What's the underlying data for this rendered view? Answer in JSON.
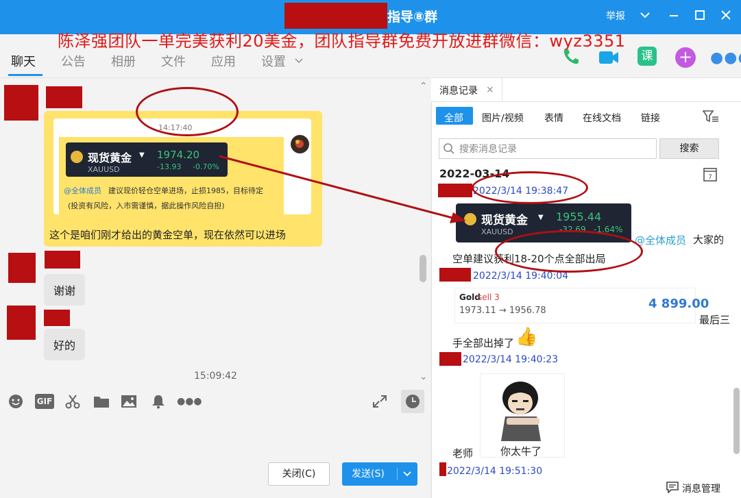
{
  "window": {
    "title": "指导⑧群",
    "report_label": "举报"
  },
  "banner": "陈泽强团队一单完美获利20美金，团队指导群免费开放进群微信：wyz3351",
  "tabs": [
    "聊天",
    "公告",
    "相册",
    "文件",
    "应用",
    "设置"
  ],
  "header_icons": {
    "phone": "phone-icon",
    "video": "video-icon",
    "course": "课",
    "add": "plus-icon",
    "more": "more-icon"
  },
  "chat": {
    "card": {
      "time": "14:17:40",
      "name": "现货黄金",
      "price": "1974.20",
      "symbol": "XAUUSD",
      "change": "-13.93",
      "pct": "-0.70%",
      "mention": "@全体成员",
      "text1": "建议现价轻仓空单进场，止损1985，目标待定",
      "text2": "(投资有风险，入市需谨慎，据此操作风险自担)"
    },
    "caption": "这个是咱们刚才给出的黄金空单，现在依然可以进场",
    "msg_thanks": "谢谢",
    "msg_ok": "好的",
    "bottom_time": "15:09:42"
  },
  "toolbar": {
    "gif": "GIF"
  },
  "buttons": {
    "close": "关闭(C)",
    "send": "发送(S)"
  },
  "history": {
    "tab_title": "消息记录",
    "filters": [
      "全部",
      "图片/视频",
      "表情",
      "在线文档",
      "链接"
    ],
    "search_placeholder": "搜索消息记录",
    "search_button": "搜索",
    "date": "2022-03-14",
    "entries": [
      {
        "time": "2022/3/14 19:38:47"
      },
      {
        "time": "2022/3/14 19:40:04"
      },
      {
        "time": "2022/3/14 19:40:23"
      },
      {
        "time": "2022/3/14 19:51:30"
      }
    ],
    "card": {
      "name": "现货黄金",
      "price": "1955.44",
      "symbol": "XAUUSD",
      "change": "-32.69",
      "pct": "-1.64%"
    },
    "mention": "@全体成员",
    "mention_tail": "大家的",
    "line2": "空单建议获利18-20个点全部出局",
    "trade": {
      "label": "Gold",
      "side": "sell 3",
      "route": "1973.11 → 1956.78",
      "profit": "4 899.00"
    },
    "tail_last3": "最后三",
    "line3": "手全部出掉了",
    "teacher": "老师",
    "sticker_text": "你太牛了",
    "manage": "消息管理"
  },
  "colors": {
    "accent": "#1e92ea",
    "redact": "#b80f12",
    "price_up": "#37c47a",
    "price_down": "#e34d4d"
  }
}
